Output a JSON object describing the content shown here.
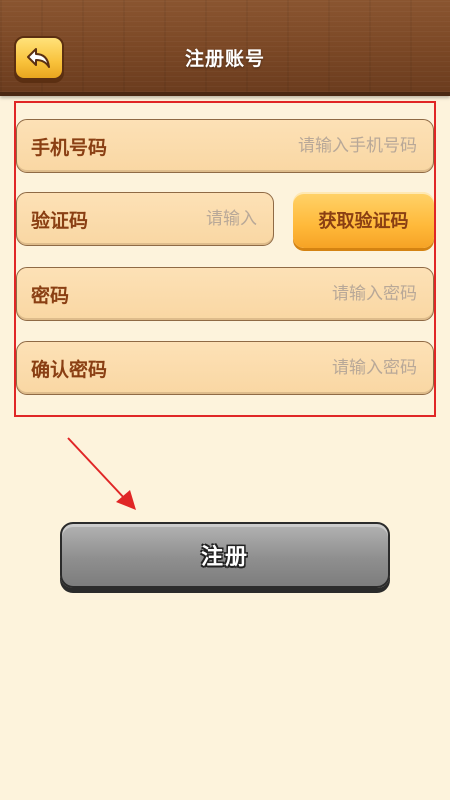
{
  "header": {
    "title": "注册账号",
    "back_icon": "back-arrow-icon"
  },
  "form": {
    "phone": {
      "label": "手机号码",
      "placeholder": "请输入手机号码",
      "value": ""
    },
    "code": {
      "label": "验证码",
      "placeholder": "请输入",
      "value": ""
    },
    "get_code_label": "获取验证码",
    "password": {
      "label": "密码",
      "placeholder": "请输入密码",
      "value": ""
    },
    "confirm_password": {
      "label": "确认密码",
      "placeholder": "请输入密码",
      "value": ""
    }
  },
  "register_label": "注册",
  "colors": {
    "background": "#fdf3dc",
    "header_wood": "#7a4725",
    "field_fill": "#fbdcaf",
    "label_text": "#8a3f13",
    "accent_button": "#ffb93a",
    "register_button": "#8f8f8f",
    "highlight_frame": "#e02626",
    "annotation_arrow": "#e02626"
  }
}
